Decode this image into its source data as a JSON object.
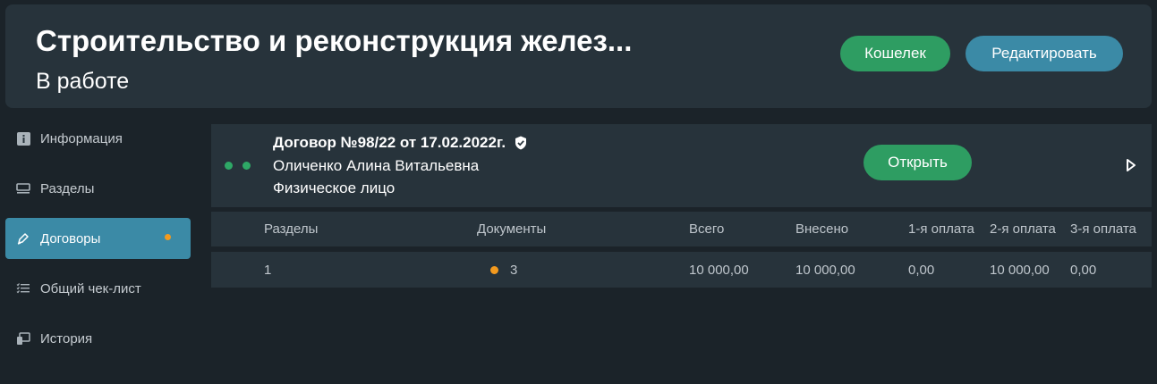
{
  "header": {
    "title": "Строительство и реконструкция желез...",
    "status": "В работе",
    "wallet_label": "Кошелек",
    "edit_label": "Редактировать"
  },
  "sidebar": {
    "items": [
      {
        "label": "Информация",
        "icon": "info-icon"
      },
      {
        "label": "Разделы",
        "icon": "sections-icon"
      },
      {
        "label": "Договоры",
        "icon": "pen-icon"
      },
      {
        "label": "Общий чек-лист",
        "icon": "checklist-icon"
      },
      {
        "label": "История",
        "icon": "devices-icon"
      }
    ]
  },
  "contract": {
    "title": "Договор №98/22 от 17.02.2022г.",
    "name": "Оличенко Алина Витальевна",
    "type": "Физическое лицо",
    "open_label": "Открыть"
  },
  "table": {
    "headers": [
      "Разделы",
      "Документы",
      "Всего",
      "Внесено",
      "1-я оплата",
      "2-я оплата",
      "3-я оплата"
    ],
    "row": [
      "1",
      "3",
      "10 000,00",
      "10 000,00",
      "0,00",
      "10 000,00",
      "0,00"
    ]
  },
  "colors": {
    "accent_green": "#2e9d62",
    "accent_blue": "#3b8aa6",
    "dot_orange": "#f39a1e",
    "panel": "#27333b",
    "background": "#1b2329"
  }
}
